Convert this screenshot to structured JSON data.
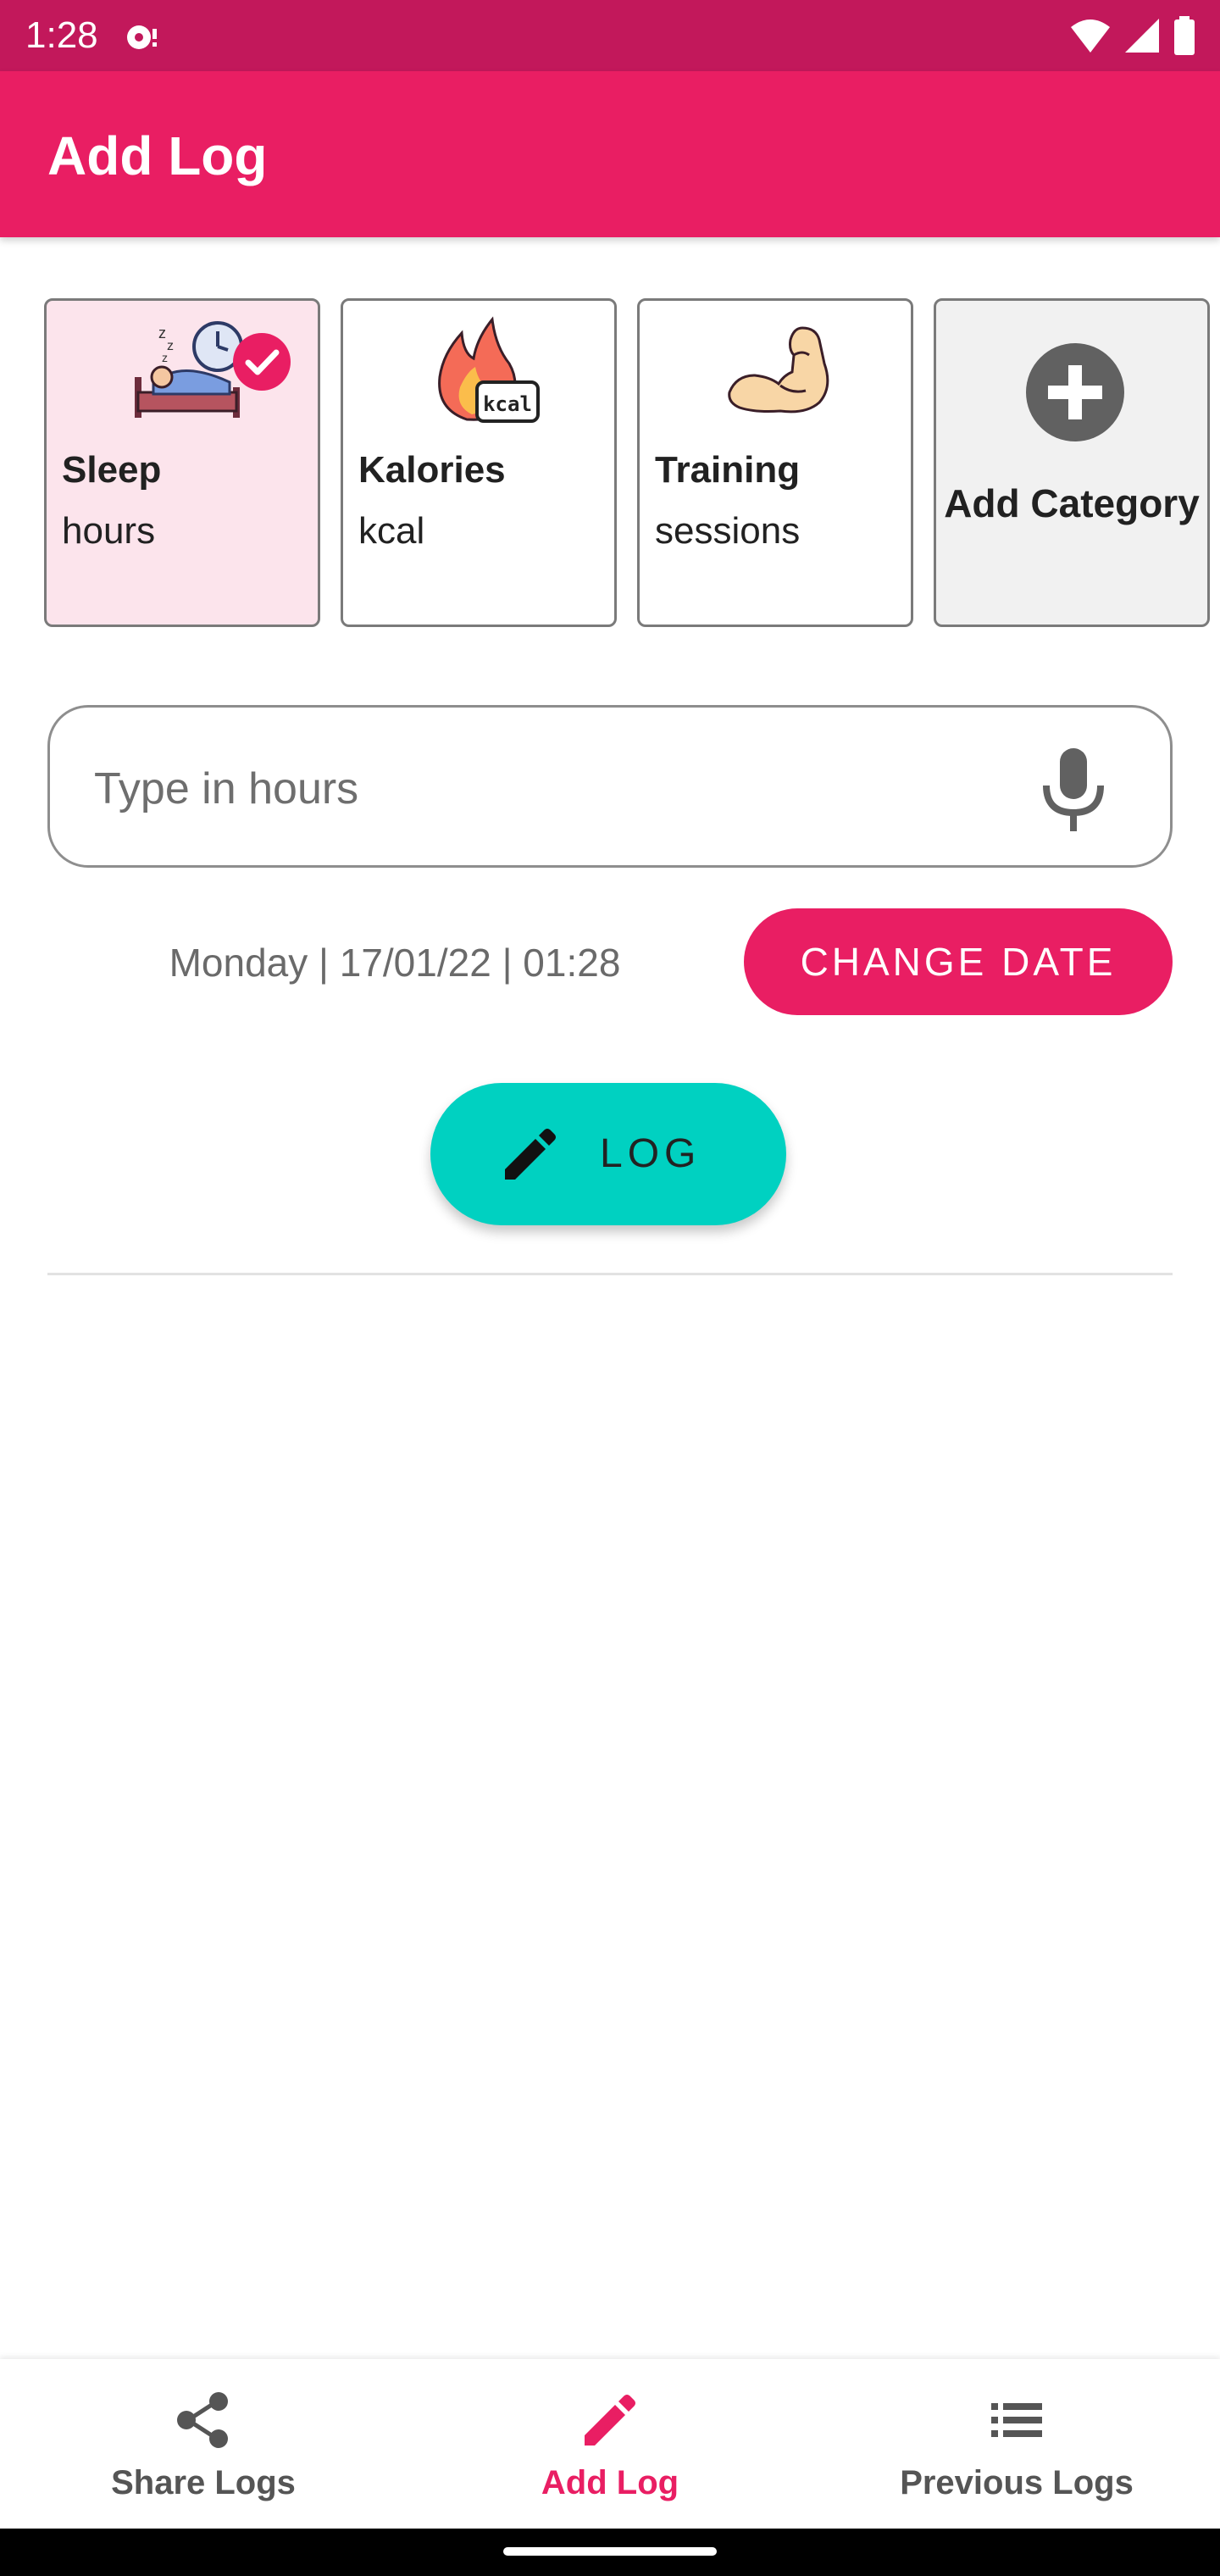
{
  "status_bar": {
    "time": "1:28"
  },
  "app_bar": {
    "title": "Add Log"
  },
  "categories": [
    {
      "name": "Sleep",
      "unit": "hours",
      "icon": "sleep-icon",
      "selected": true
    },
    {
      "name": "Kalories",
      "unit": "kcal",
      "icon": "fire-kcal-icon",
      "selected": false
    },
    {
      "name": "Training",
      "unit": "sessions",
      "icon": "muscle-icon",
      "selected": false
    }
  ],
  "add_category": {
    "label": "Add Category"
  },
  "input": {
    "placeholder": "Type in hours",
    "value": ""
  },
  "date": {
    "text": "Monday | 17/01/22 | 01:28",
    "change_label": "CHANGE DATE"
  },
  "log_button": {
    "label": "LOG"
  },
  "bottom_nav": {
    "items": [
      {
        "label": "Share Logs",
        "icon": "share-icon",
        "active": false
      },
      {
        "label": "Add Log",
        "icon": "pencil-icon",
        "active": true
      },
      {
        "label": "Previous Logs",
        "icon": "list-icon",
        "active": false
      }
    ]
  },
  "colors": {
    "primary": "#e91e63",
    "primary_dark": "#c2185b",
    "accent": "#00d1c1",
    "selected_card_bg": "#fce4ec"
  }
}
